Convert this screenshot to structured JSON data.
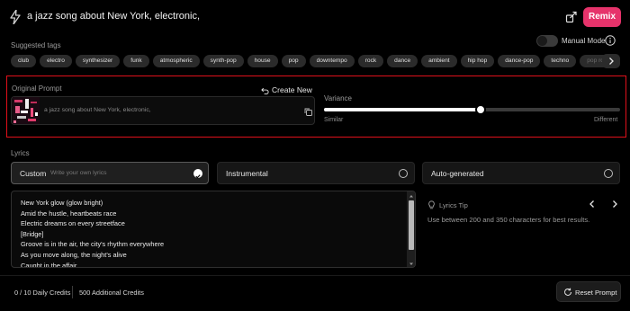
{
  "header": {
    "prompt_text": "a jazz song about New York, electronic,",
    "remix_label": "Remix",
    "accent_color": "#e6336b"
  },
  "tags": {
    "label": "Suggested tags",
    "items": [
      "club",
      "electro",
      "synthesizer",
      "funk",
      "atmospheric",
      "synth-pop",
      "house",
      "pop",
      "downtempo",
      "rock",
      "dance",
      "ambient",
      "hip hop",
      "dance-pop",
      "techno",
      "pop rock"
    ],
    "manual_mode_label": "Manual Mode",
    "manual_mode_on": false
  },
  "original_prompt": {
    "label": "Original Prompt",
    "create_new_label": "Create New",
    "text": "a jazz song about New York, electronic,",
    "variance_label": "Variance",
    "variance_value": 0.53,
    "similar_label": "Similar",
    "different_label": "Different",
    "highlight_color": "#e0101a"
  },
  "lyrics": {
    "label": "Lyrics",
    "modes": [
      {
        "name": "Custom",
        "hint": "Write your own lyrics",
        "selected": true
      },
      {
        "name": "Instrumental",
        "hint": "",
        "selected": false
      },
      {
        "name": "Auto-generated",
        "hint": "",
        "selected": false
      }
    ],
    "lines": [
      "New York glow (glow bright)",
      "Amid the hustle, heartbeats race",
      "Electric dreams on every streetface",
      "[Bridge]",
      "Groove is in the air, the city's rhythm everywhere",
      "As you move along, the night's alive",
      "Caught in the affair"
    ],
    "tip_title": "Lyrics Tip",
    "tip_text": "Use between 200 and 350 characters for best results."
  },
  "footer": {
    "daily_credits": "0 / 10 Daily Credits",
    "additional_credits": "500 Additional Credits",
    "reset_label": "Reset Prompt"
  }
}
